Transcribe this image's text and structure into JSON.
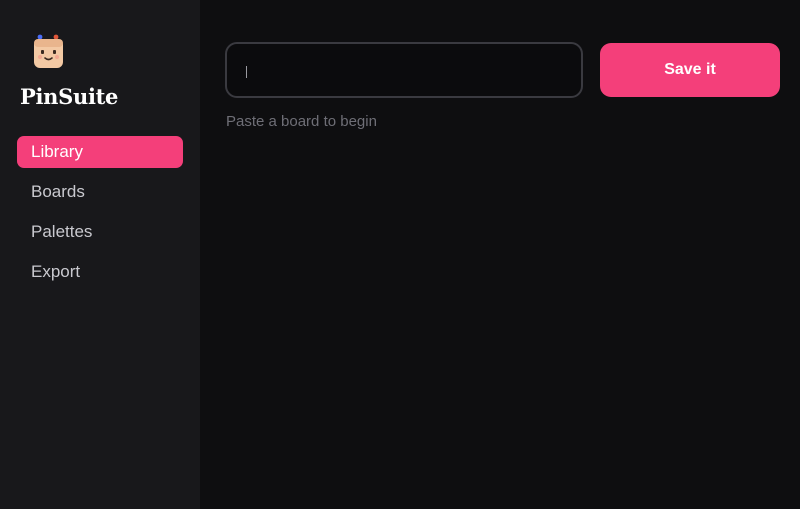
{
  "app": {
    "brand": "PinSuite",
    "logo_icon": "face-mascot-icon",
    "accent_color": "#f43f7a"
  },
  "sidebar": {
    "items": [
      {
        "label": "Library",
        "active": true
      },
      {
        "label": "Boards",
        "active": false
      },
      {
        "label": "Palettes",
        "active": false
      },
      {
        "label": "Export",
        "active": false
      }
    ]
  },
  "main": {
    "input": {
      "value": "",
      "placeholder": ""
    },
    "save_label": "Save it",
    "hint": "Paste a board to begin"
  }
}
